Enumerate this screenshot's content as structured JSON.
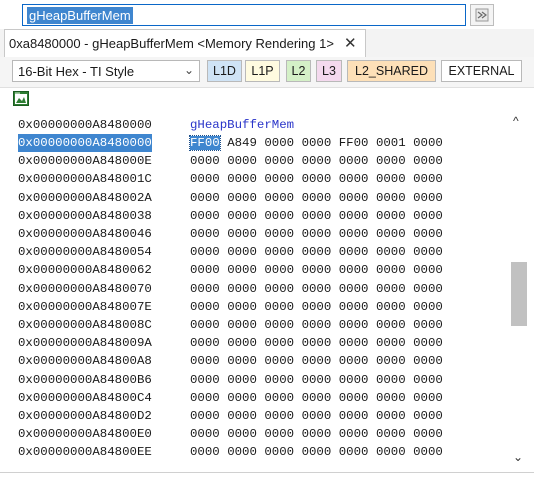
{
  "expression": {
    "value": "gHeapBufferMem"
  },
  "tab": {
    "label": "0xa8480000 - gHeapBufferMem <Memory Rendering 1>",
    "close_glyph": "✕"
  },
  "toolbar": {
    "format_value": "16-Bit Hex - TI Style",
    "layers": [
      "L1D",
      "L1P",
      "L2",
      "L3",
      "L2_SHARED",
      "EXTERNAL"
    ],
    "layer_colors": {
      "L1D": "#cfe3f5",
      "L1P": "#fffbe0",
      "L2": "#d4f0c7",
      "L3": "#f4d9ee",
      "L2_SHARED": "#fde0b8",
      "EXTERNAL": "#ffffff"
    }
  },
  "memory": {
    "label": {
      "address": "0x00000000A8480000",
      "symbol": "gHeapBufferMem"
    },
    "rows": [
      {
        "address": "0x00000000A8480000",
        "words": [
          "FF00",
          "A849",
          "0000",
          "0000",
          "FF00",
          "0001",
          "0000"
        ]
      },
      {
        "address": "0x00000000A848000E",
        "words": [
          "0000",
          "0000",
          "0000",
          "0000",
          "0000",
          "0000",
          "0000"
        ]
      },
      {
        "address": "0x00000000A848001C",
        "words": [
          "0000",
          "0000",
          "0000",
          "0000",
          "0000",
          "0000",
          "0000"
        ]
      },
      {
        "address": "0x00000000A848002A",
        "words": [
          "0000",
          "0000",
          "0000",
          "0000",
          "0000",
          "0000",
          "0000"
        ]
      },
      {
        "address": "0x00000000A8480038",
        "words": [
          "0000",
          "0000",
          "0000",
          "0000",
          "0000",
          "0000",
          "0000"
        ]
      },
      {
        "address": "0x00000000A8480046",
        "words": [
          "0000",
          "0000",
          "0000",
          "0000",
          "0000",
          "0000",
          "0000"
        ]
      },
      {
        "address": "0x00000000A8480054",
        "words": [
          "0000",
          "0000",
          "0000",
          "0000",
          "0000",
          "0000",
          "0000"
        ]
      },
      {
        "address": "0x00000000A8480062",
        "words": [
          "0000",
          "0000",
          "0000",
          "0000",
          "0000",
          "0000",
          "0000"
        ]
      },
      {
        "address": "0x00000000A8480070",
        "words": [
          "0000",
          "0000",
          "0000",
          "0000",
          "0000",
          "0000",
          "0000"
        ]
      },
      {
        "address": "0x00000000A848007E",
        "words": [
          "0000",
          "0000",
          "0000",
          "0000",
          "0000",
          "0000",
          "0000"
        ]
      },
      {
        "address": "0x00000000A848008C",
        "words": [
          "0000",
          "0000",
          "0000",
          "0000",
          "0000",
          "0000",
          "0000"
        ]
      },
      {
        "address": "0x00000000A848009A",
        "words": [
          "0000",
          "0000",
          "0000",
          "0000",
          "0000",
          "0000",
          "0000"
        ]
      },
      {
        "address": "0x00000000A84800A8",
        "words": [
          "0000",
          "0000",
          "0000",
          "0000",
          "0000",
          "0000",
          "0000"
        ]
      },
      {
        "address": "0x00000000A84800B6",
        "words": [
          "0000",
          "0000",
          "0000",
          "0000",
          "0000",
          "0000",
          "0000"
        ]
      },
      {
        "address": "0x00000000A84800C4",
        "words": [
          "0000",
          "0000",
          "0000",
          "0000",
          "0000",
          "0000",
          "0000"
        ]
      },
      {
        "address": "0x00000000A84800D2",
        "words": [
          "0000",
          "0000",
          "0000",
          "0000",
          "0000",
          "0000",
          "0000"
        ]
      },
      {
        "address": "0x00000000A84800E0",
        "words": [
          "0000",
          "0000",
          "0000",
          "0000",
          "0000",
          "0000",
          "0000"
        ]
      },
      {
        "address": "0x00000000A84800EE",
        "words": [
          "0000",
          "0000",
          "0000",
          "0000",
          "0000",
          "0000",
          "0000"
        ]
      }
    ]
  },
  "scrollbar": {
    "up_glyph": "^",
    "down_glyph": "⌄"
  },
  "icons": [
    "go-icon",
    "close-icon",
    "chevron-down-icon",
    "memory-map-icon"
  ]
}
